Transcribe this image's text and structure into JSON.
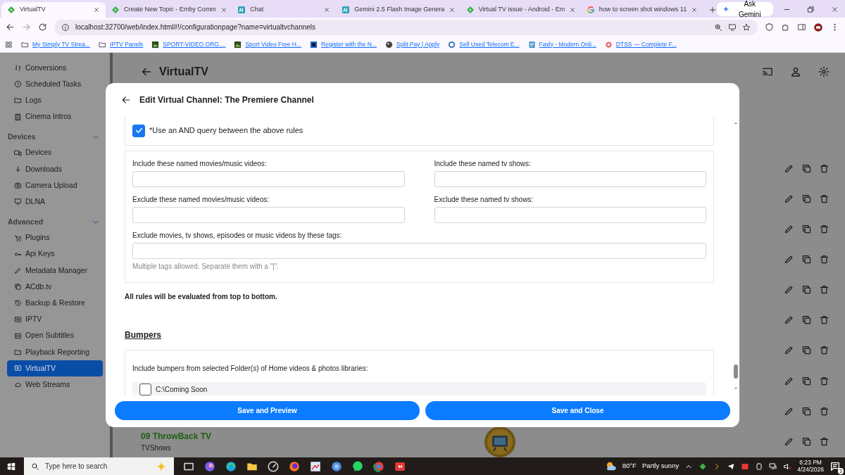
{
  "browser": {
    "tabs": [
      {
        "title": "VirtualTV",
        "kind": "emby",
        "selected": true
      },
      {
        "title": "Create New Topic - Emby Comm",
        "kind": "emby",
        "selected": false
      },
      {
        "title": "Chat",
        "kind": "ai",
        "selected": false
      },
      {
        "title": "Gemini 2.5 Flash Image Genera",
        "kind": "ai",
        "selected": false
      },
      {
        "title": "Virtual TV issue - Android - Em",
        "kind": "emby",
        "selected": false
      },
      {
        "title": "how to screen shot windows 11",
        "kind": "google",
        "selected": false
      }
    ],
    "ask_button": "Ask Gemini",
    "address": "localhost:32700/web/index.html#!/configurationpage?name=virtualtvchannels",
    "bookmarks": [
      {
        "label": "My Simply TV Strea...",
        "kind": "folder"
      },
      {
        "label": "IPTV Panels",
        "kind": "folder"
      },
      {
        "label": "SPORT-VIDEO.ORG....",
        "kind": "thumb"
      },
      {
        "label": "Sport Video Free H...",
        "kind": "thumb"
      },
      {
        "label": "Register with the N...",
        "kind": "square"
      },
      {
        "label": "Split Pay | Apply",
        "kind": "ball"
      },
      {
        "label": "Sell Used Telecom E...",
        "kind": "round"
      },
      {
        "label": "Faxly - Modern Onli...",
        "kind": "doc"
      },
      {
        "label": "DTSS — Complete F...",
        "kind": "burst"
      }
    ]
  },
  "sidebar": {
    "items": [
      {
        "label": "Conversions",
        "selected": false
      },
      {
        "label": "Scheduled Tasks",
        "selected": false
      },
      {
        "label": "Logs",
        "selected": false
      },
      {
        "label": "Cinema Intros",
        "selected": false
      }
    ],
    "sections": [
      {
        "title": "Devices",
        "expanded": true,
        "items": [
          {
            "label": "Devices",
            "selected": false
          },
          {
            "label": "Downloads",
            "selected": false
          },
          {
            "label": "Camera Upload",
            "selected": false
          },
          {
            "label": "DLNA",
            "selected": false
          }
        ]
      },
      {
        "title": "Advanced",
        "expanded": true,
        "items": [
          {
            "label": "Plugins",
            "selected": false
          },
          {
            "label": "Api Keys",
            "selected": false
          },
          {
            "label": "Metadata Manager",
            "selected": false
          },
          {
            "label": "ACdb.tv",
            "selected": false
          },
          {
            "label": "Backup & Restore",
            "selected": false
          },
          {
            "label": "IPTV",
            "selected": false
          },
          {
            "label": "Open Subtitles",
            "selected": false
          },
          {
            "label": "Playback Reporting",
            "selected": false
          },
          {
            "label": "VirtualTV",
            "selected": true
          },
          {
            "label": "Web Streams",
            "selected": false
          }
        ]
      }
    ]
  },
  "page": {
    "title": "VirtualTV",
    "channel": {
      "title": "09 ThrowBack TV",
      "subtitle": "TVShows",
      "kind": "picture"
    }
  },
  "modal": {
    "title": "Edit Virtual Channel: The Premiere Channel",
    "and_query": {
      "label": "*Use an AND query between the above rules",
      "checked": true
    },
    "field_rows": [
      {
        "fields": [
          {
            "label": "Include these named movies/music videos:"
          },
          {
            "label": "Include these named tv shows:"
          }
        ]
      },
      {
        "fields": [
          {
            "label": "Exclude these named movies/music videos:"
          },
          {
            "label": "Exclude these named tv shows:"
          }
        ]
      },
      {
        "fields": [
          {
            "label": "Exclude movies, tv shows, episodes or music videos by these tags:"
          }
        ]
      }
    ],
    "hint": "Multiple tags allowed. Separate them with a \"|\".",
    "rules_note": "All rules will be evaluated from top to bottom.",
    "bumpers": {
      "heading": "Bumpers",
      "include_label": "Include bumpers from selected Folder(s) of Home videos & photos libraries:",
      "folders": [
        {
          "path": "C:\\Coming Soon",
          "checked": false
        }
      ]
    },
    "buttons": [
      "Save and Preview",
      "Save and Close"
    ]
  },
  "taskbar": {
    "search_placeholder": "Type here to search",
    "temperature": "80°F",
    "weather": "Partly sunny",
    "time": "6:23 PM",
    "date": "4/24/2026",
    "notifications": "3"
  }
}
